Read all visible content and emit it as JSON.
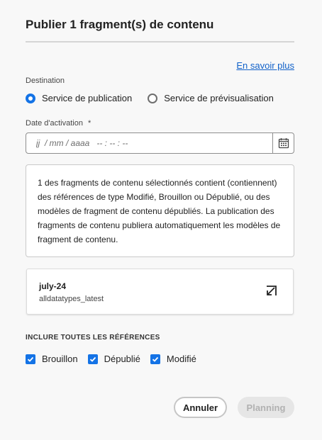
{
  "dialog": {
    "title": "Publier 1 fragment(s) de contenu",
    "learn_more": "En savoir plus"
  },
  "destination": {
    "label": "Destination",
    "options": [
      {
        "label": "Service de publication",
        "selected": true
      },
      {
        "label": "Service de prévisualisation",
        "selected": false
      }
    ]
  },
  "activation": {
    "label": "Date d'activation",
    "required_mark": "*",
    "placeholder": "jj  / mm / aaaa   -- : -- : --",
    "calendar_icon": "calendar-icon"
  },
  "info": {
    "text": "1 des fragments de contenu sélectionnés contient (contiennent) des références de type Modifié, Brouillon ou Dépublié, ou des modèles de fragment de contenu dépubliés. La publication des fragments de contenu publiera automatiquement les modèles de fragment de contenu."
  },
  "fragment": {
    "name": "july-24",
    "model": "alldatatypes_latest",
    "open_icon": "open-in-icon"
  },
  "references": {
    "heading": "INCLURE TOUTES LES RÉFÉRENCES",
    "options": [
      {
        "label": "Brouillon",
        "checked": true
      },
      {
        "label": "Dépublié",
        "checked": true
      },
      {
        "label": "Modifié",
        "checked": true
      }
    ]
  },
  "actions": {
    "cancel": "Annuler",
    "schedule": "Planning"
  },
  "colors": {
    "accent": "#1473e6",
    "link": "#1161c9",
    "disabled_bg": "#e6e6e6",
    "disabled_text": "#b1b1b1"
  }
}
